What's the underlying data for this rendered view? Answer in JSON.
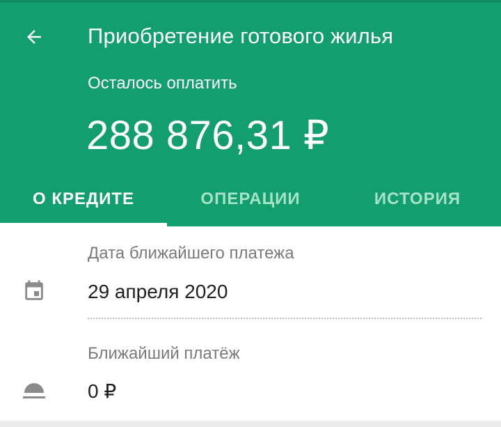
{
  "header": {
    "title": "Приобретение готового жилья",
    "remaining_label": "Осталось оплатить",
    "amount": "288 876,31 ₽",
    "back_icon": "arrow-back-icon",
    "color": "#129e6f"
  },
  "tabs": [
    {
      "label": "О КРЕДИТЕ",
      "active": true
    },
    {
      "label": "ОПЕРАЦИИ",
      "active": false
    },
    {
      "label": "ИСТОРИЯ",
      "active": false
    }
  ],
  "details": {
    "next_payment_date_label": "Дата ближайшего платежа",
    "next_payment_date_value": "29 апреля 2020",
    "next_payment_date_icon": "calendar-icon",
    "next_payment_label": "Ближайший платёж",
    "next_payment_value": "0 ₽",
    "next_payment_icon": "coins-icon"
  }
}
